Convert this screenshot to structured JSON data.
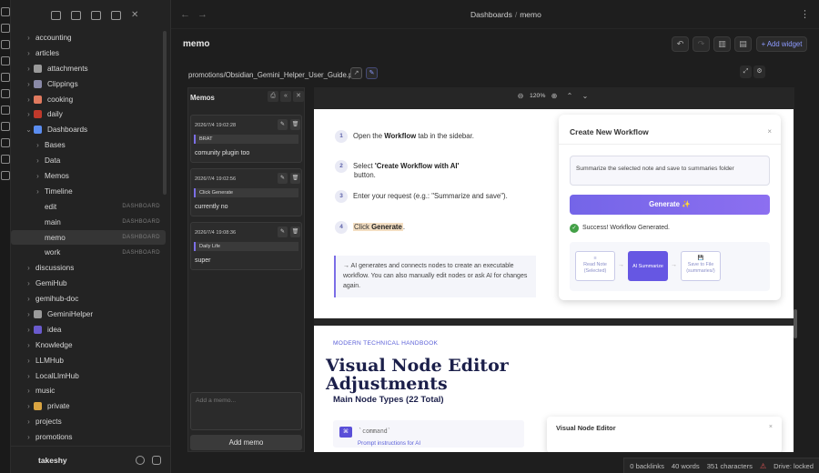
{
  "sidebar": {
    "items": [
      {
        "label": "accounting",
        "chev": "›",
        "level": 0,
        "icon": "",
        "tag": ""
      },
      {
        "label": "articles",
        "chev": "›",
        "level": 0,
        "icon": "",
        "tag": ""
      },
      {
        "label": "attachments",
        "chev": "›",
        "level": 0,
        "icon": "image-icon",
        "tag": ""
      },
      {
        "label": "Clippings",
        "chev": "›",
        "level": 0,
        "icon": "gear-icon",
        "tag": ""
      },
      {
        "label": "cooking",
        "chev": "›",
        "level": 0,
        "icon": "food-icon",
        "tag": ""
      },
      {
        "label": "daily",
        "chev": "›",
        "level": 0,
        "icon": "book-icon",
        "tag": ""
      },
      {
        "label": "Dashboards",
        "chev": "⌄",
        "level": 0,
        "icon": "chart-icon",
        "tag": ""
      },
      {
        "label": "Bases",
        "chev": "›",
        "level": 1,
        "icon": "",
        "tag": ""
      },
      {
        "label": "Data",
        "chev": "›",
        "level": 1,
        "icon": "",
        "tag": ""
      },
      {
        "label": "Memos",
        "chev": "›",
        "level": 1,
        "icon": "",
        "tag": ""
      },
      {
        "label": "Timeline",
        "chev": "›",
        "level": 1,
        "icon": "",
        "tag": ""
      },
      {
        "label": "edit",
        "chev": "",
        "level": 1,
        "icon": "",
        "tag": "DASHBOARD"
      },
      {
        "label": "main",
        "chev": "",
        "level": 1,
        "icon": "",
        "tag": "DASHBOARD"
      },
      {
        "label": "memo",
        "chev": "",
        "level": 1,
        "icon": "",
        "tag": "DASHBOARD",
        "active": true
      },
      {
        "label": "work",
        "chev": "",
        "level": 1,
        "icon": "",
        "tag": "DASHBOARD"
      },
      {
        "label": "discussions",
        "chev": "›",
        "level": 0,
        "icon": "",
        "tag": ""
      },
      {
        "label": "GemiHub",
        "chev": "›",
        "level": 0,
        "icon": "",
        "tag": ""
      },
      {
        "label": "gemihub-doc",
        "chev": "›",
        "level": 0,
        "icon": "",
        "tag": ""
      },
      {
        "label": "GeminiHelper",
        "chev": "›",
        "level": 0,
        "icon": "folder-icon",
        "tag": ""
      },
      {
        "label": "idea",
        "chev": "›",
        "level": 0,
        "icon": "notebook-icon",
        "tag": ""
      },
      {
        "label": "Knowledge",
        "chev": "›",
        "level": 0,
        "icon": "",
        "tag": ""
      },
      {
        "label": "LLMHub",
        "chev": "›",
        "level": 0,
        "icon": "",
        "tag": ""
      },
      {
        "label": "LocalLlmHub",
        "chev": "›",
        "level": 0,
        "icon": "",
        "tag": ""
      },
      {
        "label": "music",
        "chev": "›",
        "level": 0,
        "icon": "",
        "tag": ""
      },
      {
        "label": "private",
        "chev": "›",
        "level": 0,
        "icon": "doc-icon",
        "tag": ""
      },
      {
        "label": "projects",
        "chev": "›",
        "level": 0,
        "icon": "",
        "tag": ""
      },
      {
        "label": "promotions",
        "chev": "›",
        "level": 0,
        "icon": "",
        "tag": ""
      }
    ],
    "user": "takeshy"
  },
  "topbar": {
    "breadcrumb_parent": "Dashboards",
    "breadcrumb_sep": "/",
    "breadcrumb_current": "memo"
  },
  "view": {
    "title": "memo",
    "add_widget": "+ Add widget",
    "pdf_path": "promotions/Obsidian_Gemini_Helper_User_Guide.pdf"
  },
  "memos": {
    "title": "Memos",
    "cards": [
      {
        "date": "2026/7/4 19:02:28",
        "quote": "BRAT",
        "body": "comunity plugin too"
      },
      {
        "date": "2026/7/4 19:02:56",
        "quote": "Click Generate",
        "body": "currently no"
      },
      {
        "date": "2026/7/4 19:08:36",
        "quote": "Daily Life",
        "body": "super"
      }
    ],
    "placeholder": "Add a memo...",
    "add_label": "Add memo"
  },
  "pdf": {
    "zoom": "120%",
    "steps": [
      {
        "num": "1",
        "pre": "Open the ",
        "bold": "Workflow",
        "post": " tab in the sidebar.",
        "sub": ""
      },
      {
        "num": "2",
        "pre": "Select ",
        "bold": "'Create Workflow with AI'",
        "post": "",
        "sub": "button."
      },
      {
        "num": "3",
        "pre": "Enter your request (e.g.: \"Summarize and save\").",
        "bold": "",
        "post": "",
        "sub": ""
      },
      {
        "num": "4",
        "pre": "Click ",
        "bold": "Generate",
        "post": ".",
        "sub": ""
      }
    ],
    "callout": "→ AI generates and connects nodes to create an executable workflow. You can also manually edit nodes or ask AI for changes again.",
    "workflow": {
      "title": "Create New Workflow",
      "close": "×",
      "input": "Summarize the selected note and save to summaries folder",
      "generate": "Generate ✨",
      "success": "Success! Workflow Generated.",
      "nodes": [
        {
          "label": "Read Note",
          "sub": "(Selected)",
          "icon": "≡"
        },
        {
          "label": "AI Summarize",
          "sub": "",
          "icon": ""
        },
        {
          "label": "Save to File",
          "sub": "(summaries/)",
          "icon": "💾"
        }
      ]
    },
    "page2": {
      "kicker": "MODERN TECHNICAL HANDBOOK",
      "h1_line1": "Visual Node Editor",
      "h1_line2": "Adjustments",
      "h2": "Main Node Types (22 Total)",
      "code": "`command`",
      "link": "Prompt instructions for AI",
      "card_title": "Visual Node Editor",
      "card_close": "×"
    }
  },
  "status": {
    "backlinks": "0 backlinks",
    "words": "40 words",
    "chars": "351 characters",
    "drive": "Drive: locked"
  },
  "colors": {
    "accent": "#7b6ee6",
    "link": "#8d9bff",
    "bg": "#1e1e1e"
  }
}
